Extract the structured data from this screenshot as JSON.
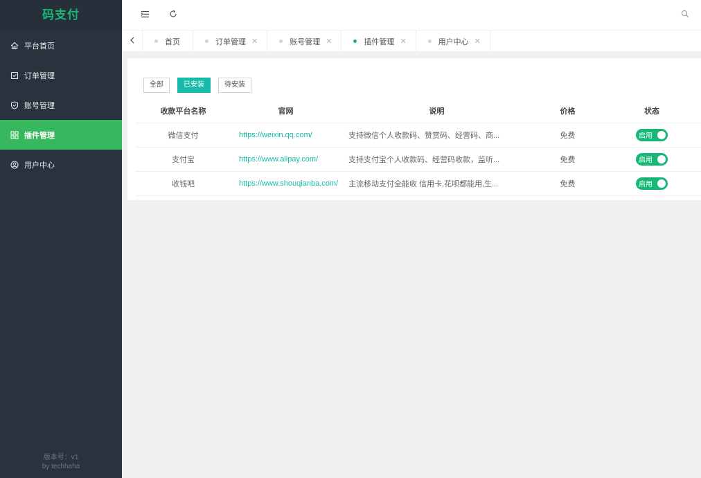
{
  "sidebar": {
    "logo": "码支付",
    "items": [
      {
        "label": "平台首页",
        "icon": "home-icon"
      },
      {
        "label": "订单管理",
        "icon": "checkbox-icon"
      },
      {
        "label": "账号管理",
        "icon": "shield-icon"
      },
      {
        "label": "插件管理",
        "icon": "grid-icon"
      },
      {
        "label": "用户中心",
        "icon": "user-circle-icon"
      }
    ],
    "active_index": 3,
    "version_line1": "版本号：v1",
    "version_line2": "by techhaha"
  },
  "tabs": [
    {
      "label": "首页",
      "closable": false
    },
    {
      "label": "订单管理",
      "closable": true
    },
    {
      "label": "账号管理",
      "closable": true
    },
    {
      "label": "插件管理",
      "closable": true,
      "active": true
    },
    {
      "label": "用户中心",
      "closable": true
    }
  ],
  "filters": {
    "all": "全部",
    "installed": "已安装",
    "pending": "待安装"
  },
  "table": {
    "headers": {
      "name": "收款平台名称",
      "site": "官网",
      "desc": "说明",
      "price": "价格",
      "status": "状态"
    },
    "rows": [
      {
        "name": "微信支付",
        "site": "https://weixin.qq.com/",
        "desc": "支持微信个人收款码、赞赏码、经营码、商...",
        "price": "免费",
        "status": "启用"
      },
      {
        "name": "支付宝",
        "site": "https://www.alipay.com/",
        "desc": "支持支付宝个人收款码、经营码收款，监听...",
        "price": "免费",
        "status": "启用"
      },
      {
        "name": "收钱吧",
        "site": "https://www.shouqianba.com/",
        "desc": "主流移动支付全能收 信用卡,花呗都能用,生...",
        "price": "免费",
        "status": "启用"
      }
    ]
  },
  "colors": {
    "sidebar_bg": "#28333e",
    "accent_green": "#16b777",
    "teal": "#16baaa"
  }
}
